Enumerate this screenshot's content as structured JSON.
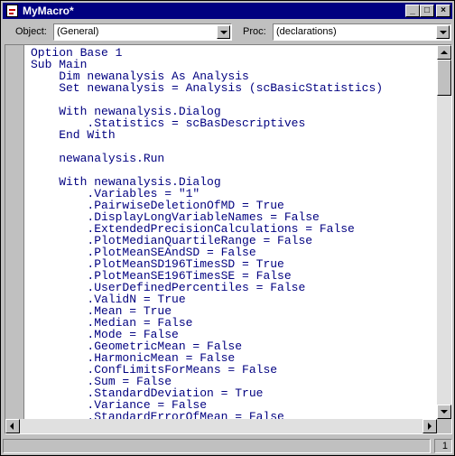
{
  "window": {
    "title": "MyMacro*"
  },
  "title_buttons": {
    "minimize": "_",
    "maximize": "□",
    "close": "×"
  },
  "toolbar": {
    "object_label": "Object:",
    "object_value": "(General)",
    "proc_label": "Proc:",
    "proc_value": "(declarations)"
  },
  "code_lines": [
    "Option Base 1",
    "Sub Main",
    "    Dim newanalysis As Analysis",
    "    Set newanalysis = Analysis (scBasicStatistics)",
    "",
    "    With newanalysis.Dialog",
    "        .Statistics = scBasDescriptives",
    "    End With",
    "",
    "    newanalysis.Run",
    "",
    "    With newanalysis.Dialog",
    "        .Variables = \"1\"",
    "        .PairwiseDeletionOfMD = True",
    "        .DisplayLongVariableNames = False",
    "        .ExtendedPrecisionCalculations = False",
    "        .PlotMedianQuartileRange = False",
    "        .PlotMeanSEAndSD = False",
    "        .PlotMeanSD196TimesSD = True",
    "        .PlotMeanSE196TimesSE = False",
    "        .UserDefinedPercentiles = False",
    "        .ValidN = True",
    "        .Mean = True",
    "        .Median = False",
    "        .Mode = False",
    "        .GeometricMean = False",
    "        .HarmonicMean = False",
    "        .ConfLimitsForMeans = False",
    "        .Sum = False",
    "        .StandardDeviation = True",
    "        .Variance = False",
    "        .StandardErrorOfMean = False"
  ],
  "status": {
    "line_number": "1"
  },
  "colors": {
    "titlebar": "#000080",
    "code_text": "#000080"
  }
}
